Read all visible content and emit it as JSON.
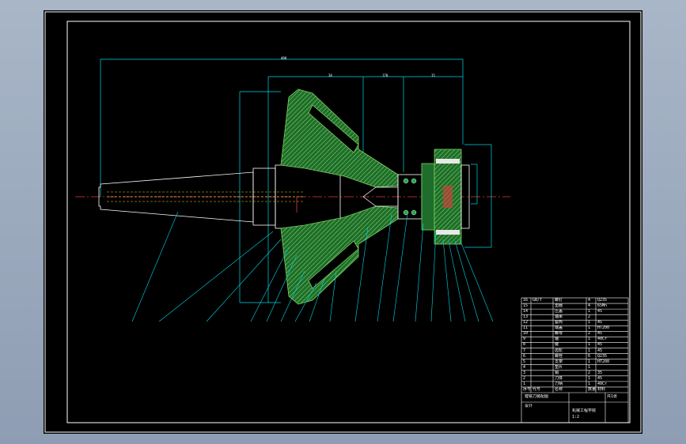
{
  "drawing": {
    "dimension_marks": [
      "400",
      "38",
      "170",
      "15"
    ],
    "colors": {
      "background": "#000000",
      "frame": "#ffffff",
      "dimension": "#00d7e8",
      "hatch": "#7dd35b",
      "section": "#29a84a",
      "centerline": "#e23b3b",
      "hidden": "#f0c040",
      "bolt": "#e8e8e8"
    }
  },
  "title_block": {
    "rows": [
      [
        "16",
        "GB/T",
        "螺钉",
        "4",
        "Q235"
      ],
      [
        "15",
        "",
        "垫圈",
        "4",
        "65Mn"
      ],
      [
        "14",
        "",
        "压盖",
        "1",
        "45"
      ],
      [
        "13",
        "",
        "轴承",
        "2",
        ""
      ],
      [
        "12",
        "",
        "套筒",
        "1",
        "45"
      ],
      [
        "11",
        "",
        "端盖",
        "1",
        "HT200"
      ],
      [
        "10",
        "",
        "螺母",
        "2",
        "45"
      ],
      [
        "9",
        "",
        "轴",
        "1",
        "40Cr"
      ],
      [
        "8",
        "",
        "键",
        "1",
        "45"
      ],
      [
        "7",
        "",
        "齿轮",
        "1",
        "45"
      ],
      [
        "6",
        "",
        "螺栓",
        "6",
        "Q235"
      ],
      [
        "5",
        "",
        "支架",
        "1",
        "HT200"
      ],
      [
        "4",
        "",
        "垫片",
        "1",
        ""
      ],
      [
        "3",
        "",
        "销",
        "2",
        "35"
      ],
      [
        "2",
        "",
        "刀体",
        "1",
        "45"
      ],
      [
        "1",
        "",
        "刀柄",
        "1",
        "40Cr"
      ]
    ],
    "header": [
      "序号",
      "代号",
      "名称",
      "数量",
      "材料"
    ],
    "drawing_name": "镗铣刀装配图",
    "scale": "1:2",
    "school": "机械工程学院",
    "designer": "设计",
    "sheet": "共1张"
  }
}
